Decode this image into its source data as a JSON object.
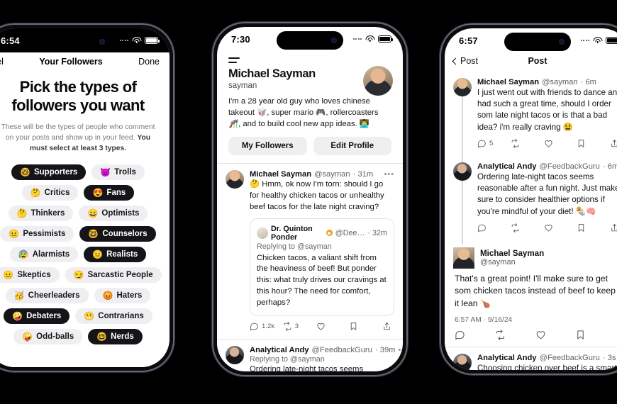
{
  "phone1": {
    "statusbar": {
      "time": "6:54"
    },
    "topbar": {
      "cancel": "ancel",
      "title": "Your Followers",
      "done": "Done"
    },
    "heading": "Pick the types of followers you want",
    "subtitle_a": "These will be the types of people who comment on your posts and show up in your feed. ",
    "subtitle_b": "You must select at least 3 types.",
    "chips": [
      {
        "emoji": "🤓",
        "label": "Supporters",
        "selected": true
      },
      {
        "emoji": "👿",
        "label": "Trolls",
        "selected": false
      },
      {
        "emoji": "🤔",
        "label": "Critics",
        "selected": false
      },
      {
        "emoji": "😍",
        "label": "Fans",
        "selected": true
      },
      {
        "emoji": "🤔",
        "label": "Thinkers",
        "selected": false
      },
      {
        "emoji": "😄",
        "label": "Optimists",
        "selected": false
      },
      {
        "emoji": "😐",
        "label": "Pessimists",
        "selected": false
      },
      {
        "emoji": "🤓",
        "label": "Counselors",
        "selected": true
      },
      {
        "emoji": "😰",
        "label": "Alarmists",
        "selected": false
      },
      {
        "emoji": "😐",
        "label": "Realists",
        "selected": true
      },
      {
        "emoji": "😐",
        "label": "Skeptics",
        "selected": false
      },
      {
        "emoji": "😏",
        "label": "Sarcastic People",
        "selected": false
      },
      {
        "emoji": "🥳",
        "label": "Cheerleaders",
        "selected": false
      },
      {
        "emoji": "😡",
        "label": "Haters",
        "selected": false
      },
      {
        "emoji": "🤪",
        "label": "Debaters",
        "selected": true
      },
      {
        "emoji": "😬",
        "label": "Contrarians",
        "selected": false
      },
      {
        "emoji": "🤪",
        "label": "Odd-balls",
        "selected": false
      },
      {
        "emoji": "🤓",
        "label": "Nerds",
        "selected": true
      }
    ]
  },
  "phone2": {
    "statusbar": {
      "time": "7:30"
    },
    "profile": {
      "name": "Michael Sayman",
      "handle": "sayman",
      "bio": "I'm a 28 year old guy who loves chinese takeout 🥡, super mario 🎮, rollercoasters 🎢, and to build cool new app ideas. 👨‍💻",
      "btn_followers": "My Followers",
      "btn_edit": "Edit Profile"
    },
    "tweet1": {
      "name": "Michael Sayman",
      "handle": "@sayman",
      "time": "31m",
      "more": "•••",
      "text": "🤔 Hmm, ok now I'm torn: should I go for healthy chicken tacos or unhealthy beef tacos for the late night craving?",
      "quote": {
        "name": "Dr. Quinton Ponder",
        "handle": "@Dee…",
        "time": "32m",
        "replying": "Replying to @sayman",
        "text": "Chicken tacos, a valiant shift from the heaviness of beef! But ponder this: what truly drives our cravings at this hour? The need for comfort, perhaps?"
      },
      "actions": {
        "reply": "1.2k",
        "repost": "3",
        "like": "",
        "bookmark": "",
        "share": ""
      }
    },
    "tweet2": {
      "name": "Analytical Andy",
      "handle": "@FeedbackGuru",
      "time": "39m",
      "more": "•••",
      "replying": "Replying to @sayman",
      "text": "Ordering late-night tacos seems"
    }
  },
  "phone3": {
    "statusbar": {
      "time": "6:57"
    },
    "nav": {
      "back": "Post",
      "title": "Post"
    },
    "tweet1": {
      "name": "Michael Sayman",
      "handle": "@sayman",
      "time": "6m",
      "text": "I just went out with friends to dance and had such a great time, should I order som late night tacos or is that a bad idea? i'm really craving 😫",
      "actions": {
        "reply": "5"
      }
    },
    "tweet2": {
      "name": "Analytical Andy",
      "handle": "@FeedbackGuru",
      "time": "6m",
      "text": "Ordering late-night tacos seems reasonable after a fun night. Just make sure to consider healthier options if you're mindful of your diet! 🌯🧠"
    },
    "main": {
      "name": "Michael Sayman",
      "handle": "@sayman",
      "text": "That's a great point! I'll make sure to get som chicken tacos instead of beef to keep it lean 🍗",
      "stamp": "6:57 AM · 9/16/24"
    },
    "tweet3": {
      "name": "Analytical Andy",
      "handle": "@FeedbackGuru",
      "time": "3s",
      "text": "Choosing chicken over beef is a smart"
    }
  }
}
